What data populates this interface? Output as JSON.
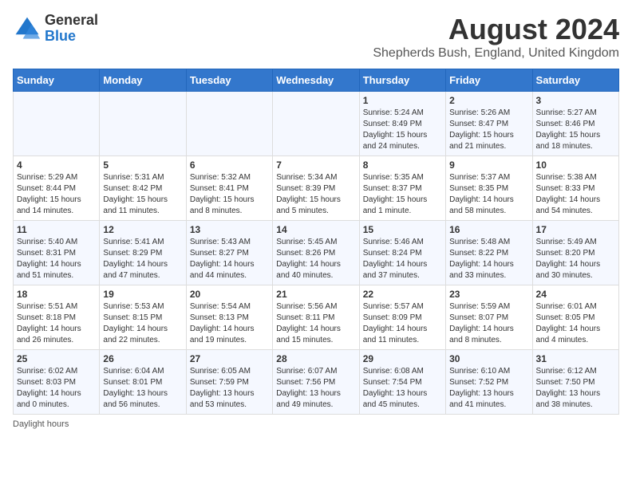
{
  "header": {
    "logo_general": "General",
    "logo_blue": "Blue",
    "main_title": "August 2024",
    "subtitle": "Shepherds Bush, England, United Kingdom"
  },
  "calendar": {
    "columns": [
      "Sunday",
      "Monday",
      "Tuesday",
      "Wednesday",
      "Thursday",
      "Friday",
      "Saturday"
    ],
    "weeks": [
      [
        {
          "day": "",
          "info": ""
        },
        {
          "day": "",
          "info": ""
        },
        {
          "day": "",
          "info": ""
        },
        {
          "day": "",
          "info": ""
        },
        {
          "day": "1",
          "info": "Sunrise: 5:24 AM\nSunset: 8:49 PM\nDaylight: 15 hours\nand 24 minutes."
        },
        {
          "day": "2",
          "info": "Sunrise: 5:26 AM\nSunset: 8:47 PM\nDaylight: 15 hours\nand 21 minutes."
        },
        {
          "day": "3",
          "info": "Sunrise: 5:27 AM\nSunset: 8:46 PM\nDaylight: 15 hours\nand 18 minutes."
        }
      ],
      [
        {
          "day": "4",
          "info": "Sunrise: 5:29 AM\nSunset: 8:44 PM\nDaylight: 15 hours\nand 14 minutes."
        },
        {
          "day": "5",
          "info": "Sunrise: 5:31 AM\nSunset: 8:42 PM\nDaylight: 15 hours\nand 11 minutes."
        },
        {
          "day": "6",
          "info": "Sunrise: 5:32 AM\nSunset: 8:41 PM\nDaylight: 15 hours\nand 8 minutes."
        },
        {
          "day": "7",
          "info": "Sunrise: 5:34 AM\nSunset: 8:39 PM\nDaylight: 15 hours\nand 5 minutes."
        },
        {
          "day": "8",
          "info": "Sunrise: 5:35 AM\nSunset: 8:37 PM\nDaylight: 15 hours\nand 1 minute."
        },
        {
          "day": "9",
          "info": "Sunrise: 5:37 AM\nSunset: 8:35 PM\nDaylight: 14 hours\nand 58 minutes."
        },
        {
          "day": "10",
          "info": "Sunrise: 5:38 AM\nSunset: 8:33 PM\nDaylight: 14 hours\nand 54 minutes."
        }
      ],
      [
        {
          "day": "11",
          "info": "Sunrise: 5:40 AM\nSunset: 8:31 PM\nDaylight: 14 hours\nand 51 minutes."
        },
        {
          "day": "12",
          "info": "Sunrise: 5:41 AM\nSunset: 8:29 PM\nDaylight: 14 hours\nand 47 minutes."
        },
        {
          "day": "13",
          "info": "Sunrise: 5:43 AM\nSunset: 8:27 PM\nDaylight: 14 hours\nand 44 minutes."
        },
        {
          "day": "14",
          "info": "Sunrise: 5:45 AM\nSunset: 8:26 PM\nDaylight: 14 hours\nand 40 minutes."
        },
        {
          "day": "15",
          "info": "Sunrise: 5:46 AM\nSunset: 8:24 PM\nDaylight: 14 hours\nand 37 minutes."
        },
        {
          "day": "16",
          "info": "Sunrise: 5:48 AM\nSunset: 8:22 PM\nDaylight: 14 hours\nand 33 minutes."
        },
        {
          "day": "17",
          "info": "Sunrise: 5:49 AM\nSunset: 8:20 PM\nDaylight: 14 hours\nand 30 minutes."
        }
      ],
      [
        {
          "day": "18",
          "info": "Sunrise: 5:51 AM\nSunset: 8:18 PM\nDaylight: 14 hours\nand 26 minutes."
        },
        {
          "day": "19",
          "info": "Sunrise: 5:53 AM\nSunset: 8:15 PM\nDaylight: 14 hours\nand 22 minutes."
        },
        {
          "day": "20",
          "info": "Sunrise: 5:54 AM\nSunset: 8:13 PM\nDaylight: 14 hours\nand 19 minutes."
        },
        {
          "day": "21",
          "info": "Sunrise: 5:56 AM\nSunset: 8:11 PM\nDaylight: 14 hours\nand 15 minutes."
        },
        {
          "day": "22",
          "info": "Sunrise: 5:57 AM\nSunset: 8:09 PM\nDaylight: 14 hours\nand 11 minutes."
        },
        {
          "day": "23",
          "info": "Sunrise: 5:59 AM\nSunset: 8:07 PM\nDaylight: 14 hours\nand 8 minutes."
        },
        {
          "day": "24",
          "info": "Sunrise: 6:01 AM\nSunset: 8:05 PM\nDaylight: 14 hours\nand 4 minutes."
        }
      ],
      [
        {
          "day": "25",
          "info": "Sunrise: 6:02 AM\nSunset: 8:03 PM\nDaylight: 14 hours\nand 0 minutes."
        },
        {
          "day": "26",
          "info": "Sunrise: 6:04 AM\nSunset: 8:01 PM\nDaylight: 13 hours\nand 56 minutes."
        },
        {
          "day": "27",
          "info": "Sunrise: 6:05 AM\nSunset: 7:59 PM\nDaylight: 13 hours\nand 53 minutes."
        },
        {
          "day": "28",
          "info": "Sunrise: 6:07 AM\nSunset: 7:56 PM\nDaylight: 13 hours\nand 49 minutes."
        },
        {
          "day": "29",
          "info": "Sunrise: 6:08 AM\nSunset: 7:54 PM\nDaylight: 13 hours\nand 45 minutes."
        },
        {
          "day": "30",
          "info": "Sunrise: 6:10 AM\nSunset: 7:52 PM\nDaylight: 13 hours\nand 41 minutes."
        },
        {
          "day": "31",
          "info": "Sunrise: 6:12 AM\nSunset: 7:50 PM\nDaylight: 13 hours\nand 38 minutes."
        }
      ]
    ]
  },
  "footer": {
    "daylight_hours_label": "Daylight hours"
  }
}
